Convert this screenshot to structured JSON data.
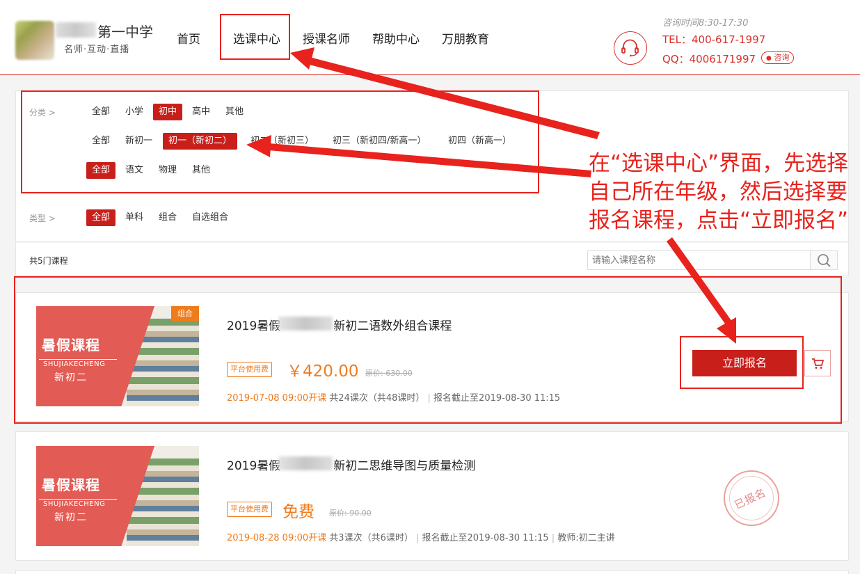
{
  "header": {
    "school_name": "第一中学",
    "school_sub": "名师·互动·直播",
    "nav": [
      "首页",
      "选课中心",
      "授课名师",
      "帮助中心",
      "万朋教育"
    ],
    "contact_hours": "咨询时间8:30-17:30",
    "contact_tel": "TEL：400-617-1997",
    "contact_qq": "QQ：4006171997",
    "consult_label": "咨询"
  },
  "filters": {
    "category_label": "分类 >",
    "level_row": [
      "全部",
      "小学",
      "初中",
      "高中",
      "其他"
    ],
    "grade_row": [
      "全部",
      "新初一",
      "初一（新初二）",
      "初二（新初三）",
      "初三（新初四/新高一）",
      "初四（新高一）"
    ],
    "subject_row": [
      "全部",
      "语文",
      "物理",
      "其他"
    ],
    "type_label": "类型 >",
    "type_row": [
      "全部",
      "单科",
      "组合",
      "自选组合"
    ]
  },
  "list": {
    "count_text": "共5门课程",
    "search_placeholder": "请输入课程名称"
  },
  "courses": [
    {
      "thumb_title": "暑假课程",
      "thumb_pinyin": "SHUJIAKECHENG",
      "thumb_grade": "新初二",
      "tag": "组合",
      "title_prefix": "2019暑假",
      "title_suffix": "新初二语数外组合课程",
      "fee_badge": "平台使用费",
      "price": "￥420.00",
      "orig_price": "原价: 630.00",
      "start": "2019-07-08 09:00开课",
      "sessions": "共24课次（共48课时）",
      "deadline": "报名截止至2019-08-30 11:15",
      "enroll_label": "立即报名"
    },
    {
      "thumb_title": "暑假课程",
      "thumb_pinyin": "SHUJIAKECHENG",
      "thumb_grade": "新初二",
      "title_prefix": "2019暑假",
      "title_suffix": "新初二思维导图与质量检测",
      "fee_badge": "平台使用费",
      "price": "免费",
      "orig_price": "原价: 90.00",
      "start": "2019-08-28 09:00开课",
      "sessions": "共3课次（共6课时）",
      "deadline": "报名截止至2019-08-30 11:15",
      "teacher": "教师:初二主讲",
      "stamp_label": "已报名"
    }
  ],
  "annotation": {
    "text": "在“选课中心”界面，先选择自己所在年级，然后选择要报名课程，点击“立即报名”"
  },
  "colors": {
    "brand_red": "#c81f1b",
    "annotation_red": "#e8221c",
    "price_orange": "#ef7b1c"
  }
}
